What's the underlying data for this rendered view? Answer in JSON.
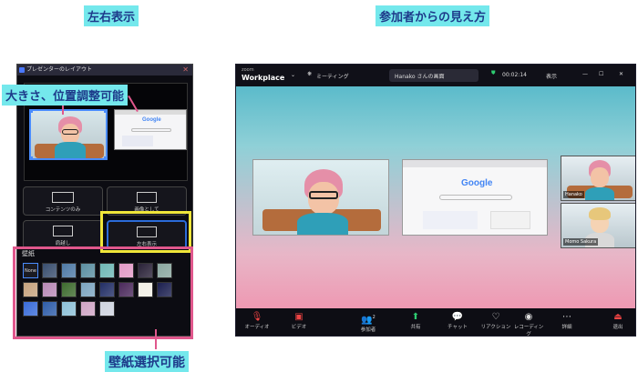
{
  "captions": {
    "left": "左右表示",
    "right": "参加者からの見え方",
    "resize": "大きさ、位置調整可能",
    "wallpaper": "壁紙選択可能"
  },
  "layout_panel": {
    "title": "プレゼンターのレイアウト",
    "options": [
      {
        "label": "コンテンツのみ"
      },
      {
        "label": "画像として"
      },
      {
        "label": "肩越し"
      },
      {
        "label": "左右表示",
        "selected": true
      }
    ],
    "wallpaper_label": "壁紙",
    "none_label": "None",
    "swatches": [
      "#3a4f6f",
      "#4f7aa6",
      "#5c8fa1",
      "#6fb8b6",
      "#e29ac6",
      "#2a2238",
      "#8aa7a0",
      "#c7a37f",
      "#b98ab7",
      "#3e6b2f",
      "#7da5c0",
      "#232f66",
      "#4b2a5c",
      "#f2efe6",
      "#1b1f4f",
      "#3a6cd9",
      "#2f5da8",
      "#8ec1d8",
      "#d0a6c5",
      "#cfd4df"
    ]
  },
  "zoom": {
    "brand_line1": "zoom",
    "brand_line2": "Workplace",
    "meeting_label": "ミーティング",
    "screen_owner": "Hanako さんの画面",
    "timer": "00:02:14",
    "view_label": "表示",
    "google": "Google",
    "participants": [
      {
        "name": "Hanako"
      },
      {
        "name": "Momo Sakura"
      }
    ],
    "participant_count": "2",
    "toolbar": [
      {
        "label": "オーディオ",
        "icon": "mic-muted-icon"
      },
      {
        "label": "ビデオ",
        "icon": "video-icon"
      },
      {
        "label": "参加者",
        "icon": "participants-icon"
      },
      {
        "label": "共有",
        "icon": "share-icon"
      },
      {
        "label": "チャット",
        "icon": "chat-icon"
      },
      {
        "label": "リアクション",
        "icon": "reaction-icon"
      },
      {
        "label": "レコーディング",
        "icon": "record-icon"
      },
      {
        "label": "詳細",
        "icon": "more-icon"
      },
      {
        "label": "退出",
        "icon": "leave-icon"
      }
    ]
  }
}
